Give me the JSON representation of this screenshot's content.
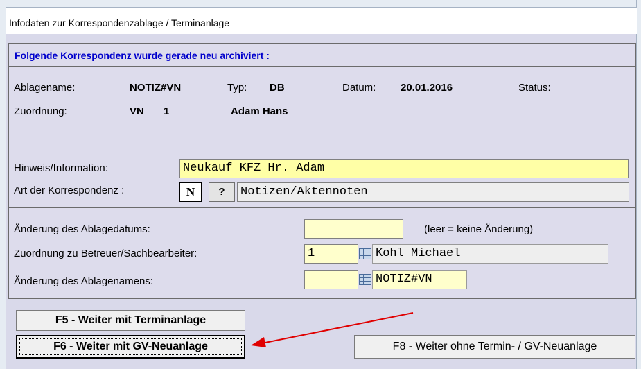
{
  "window": {
    "title": "Infodaten zur Korrespondenzablage / Terminanlage"
  },
  "header": {
    "message": "Folgende Korrespondenz wurde gerade neu archiviert :"
  },
  "info": {
    "ablagename_label": "Ablagename:",
    "ablagename_value": "NOTIZ#VN",
    "typ_label": "Typ:",
    "typ_value": "DB",
    "datum_label": "Datum:",
    "datum_value": "20.01.2016",
    "status_label": "Status:",
    "zuordnung_label": "Zuordnung:",
    "zuordnung_code": "VN",
    "zuordnung_nr": "1",
    "zuordnung_name": "Adam Hans"
  },
  "hinweis": {
    "label": "Hinweis/Information:",
    "value": "Neukauf KFZ Hr. Adam",
    "art_label": "Art der Korrespondenz :",
    "art_code": "N",
    "art_help": "?",
    "art_text": "Notizen/Aktennoten"
  },
  "changes": {
    "datum_label": "Änderung des Ablagedatums:",
    "datum_value": "",
    "datum_hint": "(leer = keine Änderung)",
    "betreuer_label": "Zuordnung zu Betreuer/Sachbearbeiter:",
    "betreuer_value": "1",
    "betreuer_name": "Kohl Michael",
    "ablagename_label": "Änderung des Ablagenamens:",
    "ablagename_value": "NOTIZ#VN"
  },
  "buttons": {
    "f5": "F5 -  Weiter mit Terminanlage",
    "f6": "F6 -  Weiter mit GV-Neuanlage",
    "f8": "F8  -  Weiter ohne Termin- / GV-Neuanlage"
  },
  "colors": {
    "annotation_arrow": "#e00000",
    "header_text": "#0000cc",
    "input_yellow": "#ffffa6"
  },
  "icons": [
    "table-lookup-icon",
    "table-lookup-icon"
  ]
}
